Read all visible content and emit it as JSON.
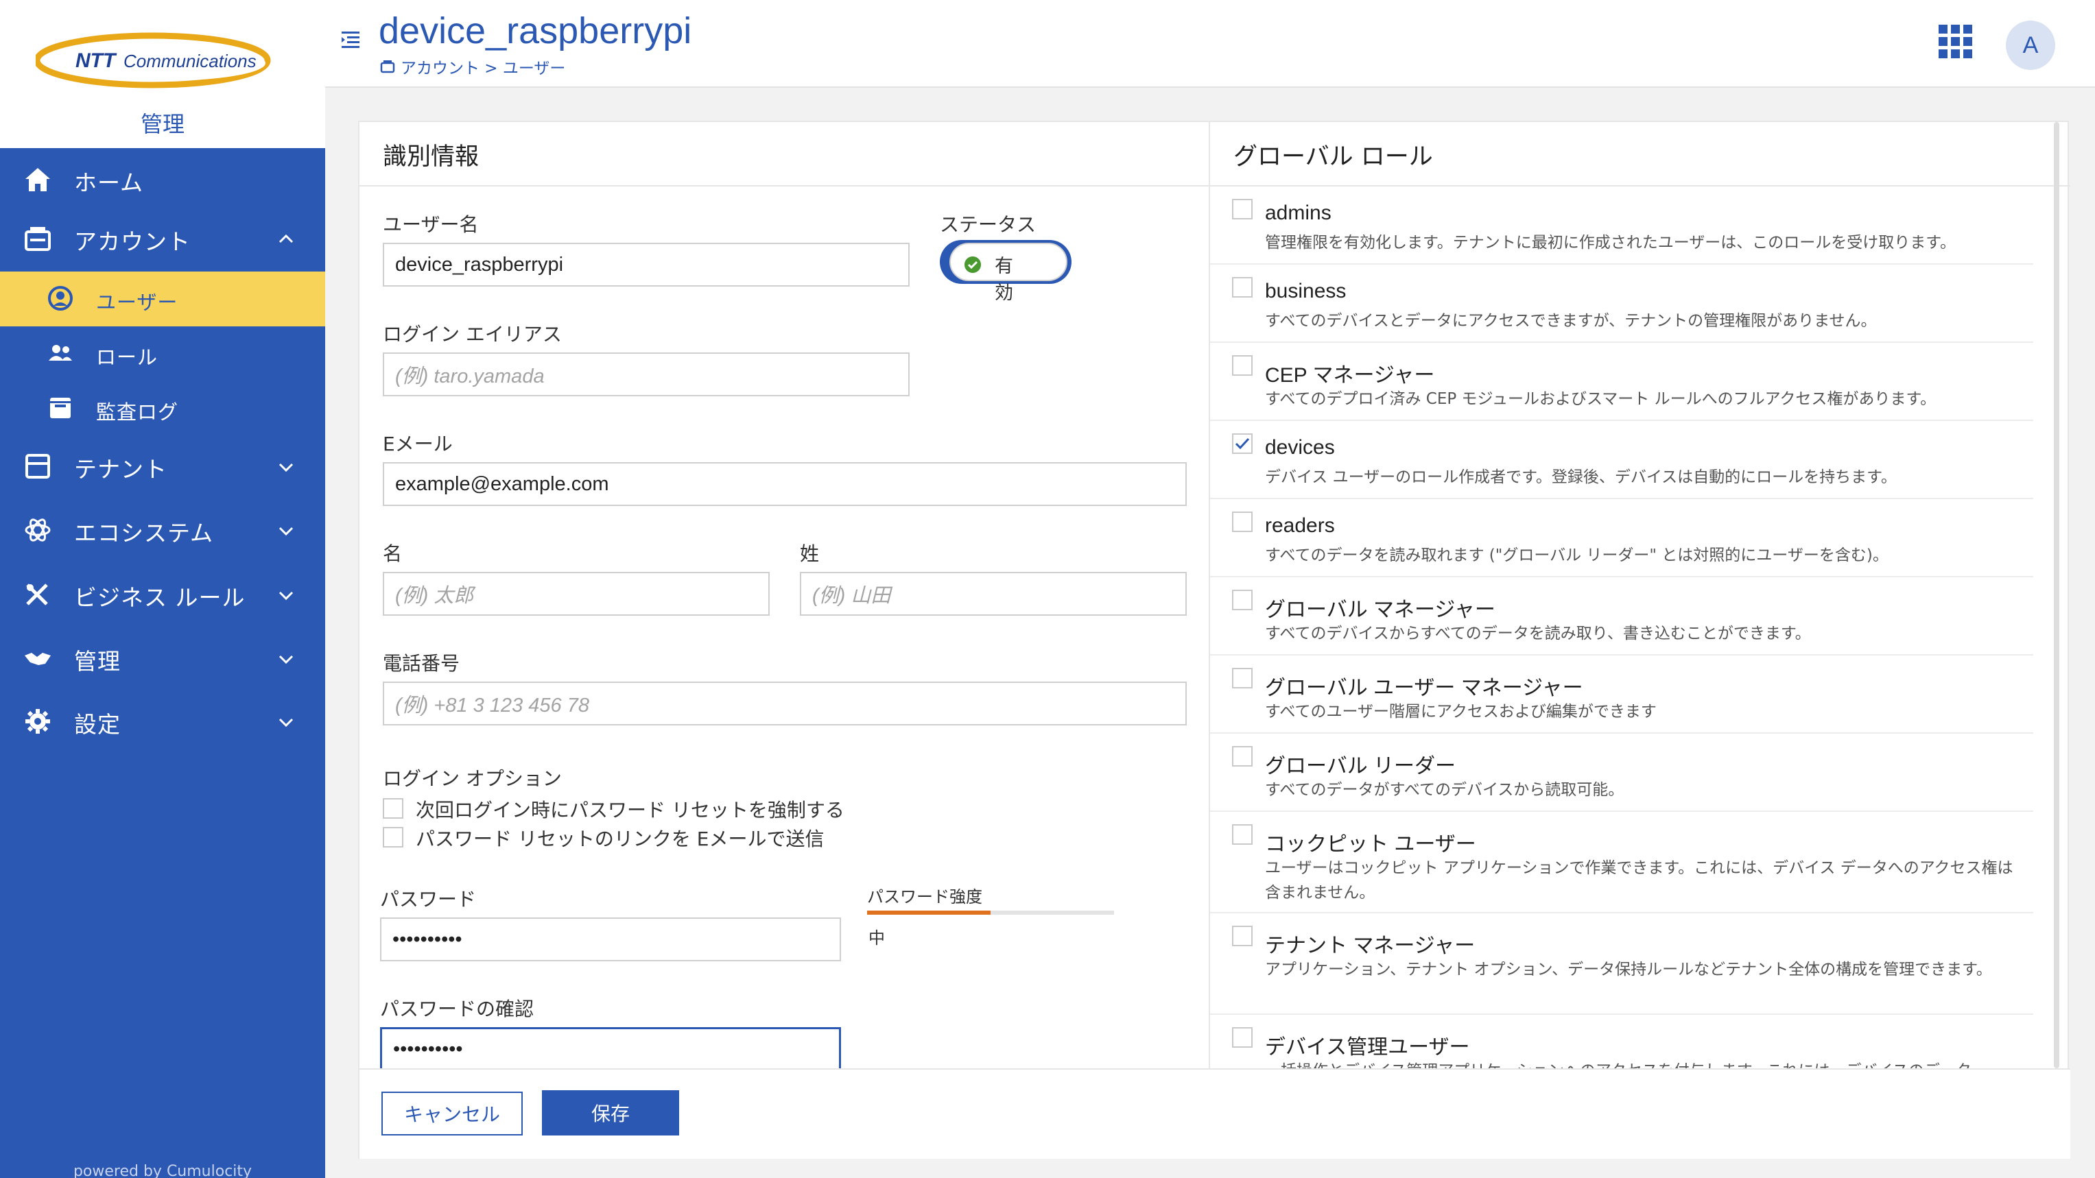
{
  "brand": {
    "logo_text_a": "NTT",
    "logo_text_b": "Communications",
    "label": "管理"
  },
  "sidebar": {
    "items": [
      {
        "label": "ホーム",
        "icon": "home-icon"
      },
      {
        "label": "アカウント",
        "icon": "account-icon",
        "expanded": true
      },
      {
        "label": "テナント",
        "icon": "tenant-icon"
      },
      {
        "label": "エコシステム",
        "icon": "ecosystem-icon"
      },
      {
        "label": "ビジネス ルール",
        "icon": "business-rules-icon"
      },
      {
        "label": "管理",
        "icon": "management-icon"
      },
      {
        "label": "設定",
        "icon": "gear-icon"
      }
    ],
    "subitems": [
      {
        "label": "ユーザー",
        "icon": "user-circle-icon",
        "active": true
      },
      {
        "label": "ロール",
        "icon": "roles-icon"
      },
      {
        "label": "監査ログ",
        "icon": "audit-log-icon"
      }
    ],
    "powered_by": "powered by Cumulocity"
  },
  "header": {
    "title": "device_raspberrypi",
    "breadcrumb": "アカウント > ユーザー",
    "avatar_initial": "A"
  },
  "identity": {
    "heading": "識別情報",
    "username_label": "ユーザー名",
    "username_value": "device_raspberrypi",
    "status_label": "ステータス",
    "status_value": "有効",
    "alias_label": "ログイン エイリアス",
    "alias_placeholder": "(例) taro.yamada",
    "email_label": "Eメール",
    "email_value": "example@example.com",
    "first_name_label": "名",
    "first_name_placeholder": "(例) 太郎",
    "last_name_label": "姓",
    "last_name_placeholder": "(例) 山田",
    "phone_label": "電話番号",
    "phone_placeholder": "(例) +81 3 123 456 78",
    "login_options_label": "ログイン オプション",
    "option_force_reset": "次回ログイン時にパスワード リセットを強制する",
    "option_send_link": "パスワード リセットのリンクを Eメールで送信",
    "password_label": "パスワード",
    "password_value": "••••••••••",
    "password_strength_label": "パスワード強度",
    "password_strength_value": "中",
    "password_strength_fraction": 0.5,
    "confirm_label": "パスワードの確認",
    "confirm_value": "••••••••••"
  },
  "roles": {
    "heading": "グローバル ロール",
    "items": [
      {
        "name": "admins",
        "desc": "管理権限を有効化します。テナントに最初に作成されたユーザーは、このロールを受け取ります。",
        "checked": false
      },
      {
        "name": "business",
        "desc": "すべてのデバイスとデータにアクセスできますが、テナントの管理権限がありません。",
        "checked": false
      },
      {
        "name": "CEP マネージャー",
        "desc": "すべてのデプロイ済み CEP モジュールおよびスマート ルールへのフルアクセス権があります。",
        "checked": false
      },
      {
        "name": "devices",
        "desc": "デバイス ユーザーのロール作成者です。登録後、デバイスは自動的にロールを持ちます。",
        "checked": true
      },
      {
        "name": "readers",
        "desc": "すべてのデータを読み取れます (\"グローバル リーダー\" とは対照的にユーザーを含む)。",
        "checked": false
      },
      {
        "name": "グローバル マネージャー",
        "desc": "すべてのデバイスからすべてのデータを読み取り、書き込むことができます。",
        "checked": false
      },
      {
        "name": "グローバル ユーザー マネージャー",
        "desc": "すべてのユーザー階層にアクセスおよび編集ができます",
        "checked": false
      },
      {
        "name": "グローバル リーダー",
        "desc": "すべてのデータがすべてのデバイスから読取可能。",
        "checked": false
      },
      {
        "name": "コックピット ユーザー",
        "desc": "ユーザーはコックピット アプリケーションで作業できます。これには、デバイス データへのアクセス権は含まれません。",
        "checked": false
      },
      {
        "name": "テナント マネージャー",
        "desc": "アプリケーション、テナント オプション、データ保持ルールなどテナント全体の構成を管理できます。",
        "checked": false
      },
      {
        "name": "デバイス管理ユーザー",
        "desc": "一括操作とデバイス管理アプリケーションへのアクセスを付与します。これには、デバイスのデータ",
        "checked": false
      }
    ]
  },
  "footer": {
    "cancel_label": "キャンセル",
    "save_label": "保存"
  },
  "colors": {
    "primary": "#2b58b3",
    "active_item": "#f8d35a",
    "strength_medium": "#e0711f",
    "status_ok": "#4a9a31"
  }
}
